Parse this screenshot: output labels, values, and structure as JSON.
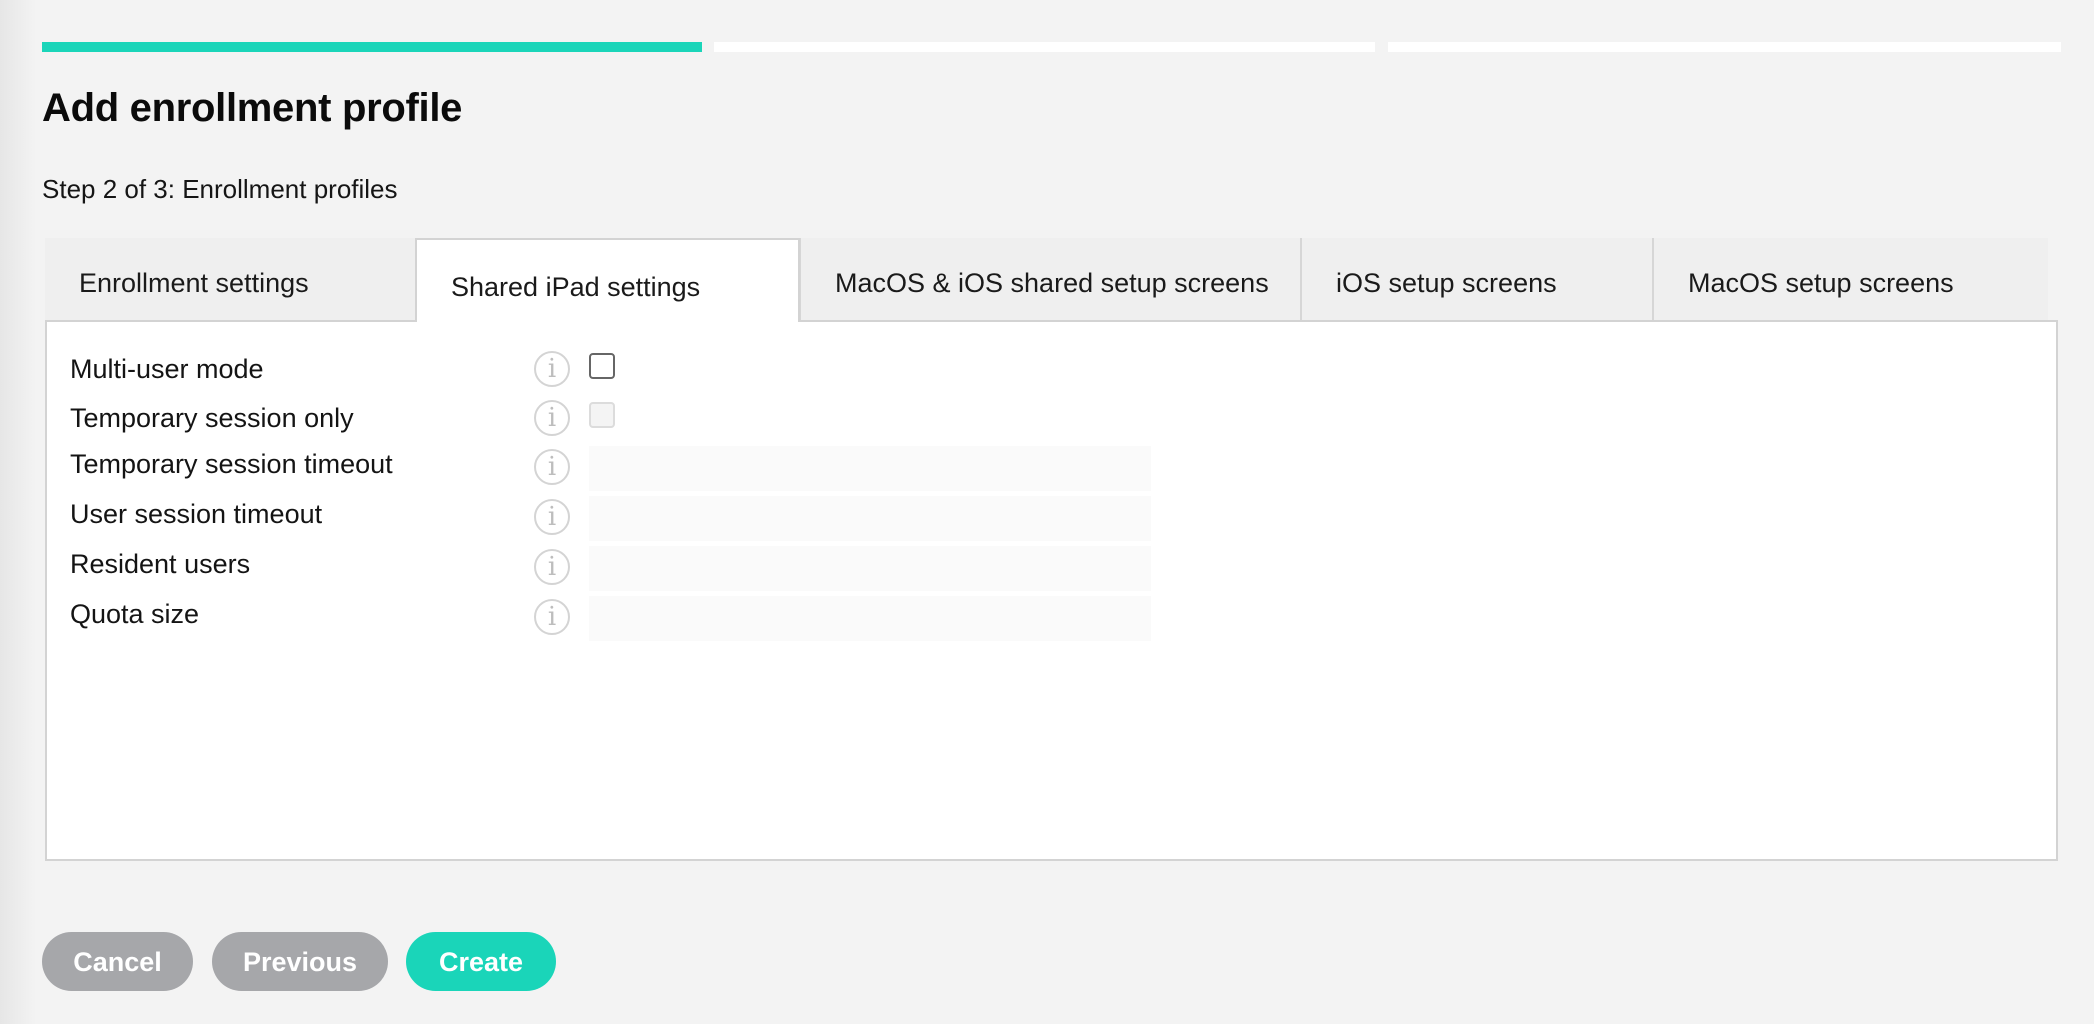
{
  "wizard": {
    "total_steps": 3,
    "current_step": 2,
    "progress_segments": [
      {
        "state": "complete"
      },
      {
        "state": "incomplete"
      },
      {
        "state": "incomplete"
      }
    ]
  },
  "header": {
    "title": "Add enrollment profile",
    "subtitle": "Step 2 of 3: Enrollment profiles"
  },
  "tabs": [
    {
      "label": "Enrollment settings",
      "active": false
    },
    {
      "label": "Shared iPad settings",
      "active": true
    },
    {
      "label": "MacOS & iOS shared setup screens",
      "active": false
    },
    {
      "label": "iOS setup screens",
      "active": false
    },
    {
      "label": "MacOS setup screens",
      "active": false
    }
  ],
  "form": {
    "info_icon_glyph": "i",
    "fields": [
      {
        "label": "Multi-user mode",
        "type": "checkbox",
        "checked": false,
        "disabled": false
      },
      {
        "label": "Temporary session only",
        "type": "checkbox",
        "checked": false,
        "disabled": true
      },
      {
        "label": "Temporary session timeout",
        "type": "text",
        "value": "",
        "disabled": true
      },
      {
        "label": "User session timeout",
        "type": "text",
        "value": "",
        "disabled": true
      },
      {
        "label": "Resident users",
        "type": "text",
        "value": "",
        "disabled": true
      },
      {
        "label": "Quota size",
        "type": "text",
        "value": "",
        "disabled": true
      }
    ]
  },
  "buttons": {
    "cancel": "Cancel",
    "previous": "Previous",
    "create": "Create"
  },
  "colors": {
    "accent": "#1ad5b9",
    "button_gray": "#a6a7aa",
    "background": "#f3f3f3",
    "border": "#d3d3d3"
  }
}
